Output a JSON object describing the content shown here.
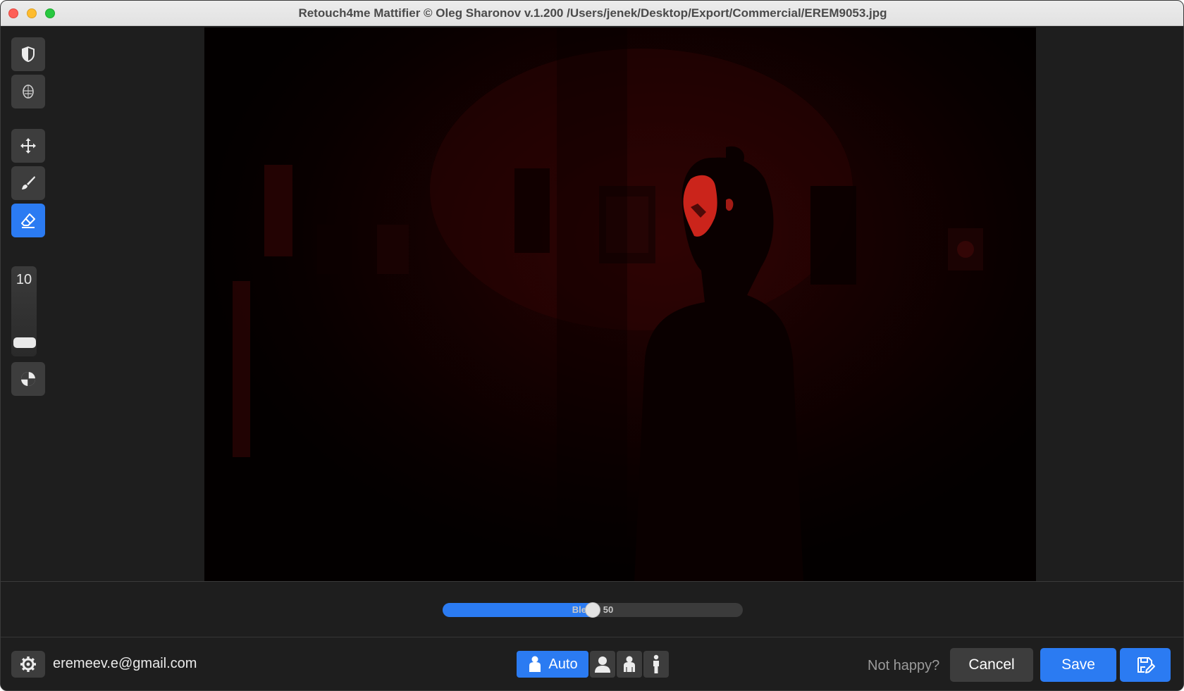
{
  "window": {
    "title": "Retouch4me Mattifier © Oleg Sharonov v.1.200 /Users/jenek/Desktop/Export/Commercial/EREM9053.jpg"
  },
  "toolbar": {
    "tools": [
      {
        "name": "mask-view-icon",
        "active": false
      },
      {
        "name": "face-view-icon",
        "active": false
      },
      {
        "name": "move-icon",
        "active": false
      },
      {
        "name": "brush-icon",
        "active": false
      },
      {
        "name": "eraser-icon",
        "active": true
      },
      {
        "name": "contrast-icon",
        "active": false
      }
    ],
    "brush_size": "10"
  },
  "blend": {
    "label": "Blend: 50",
    "value": 50,
    "max": 100
  },
  "footer": {
    "email": "eremeev.e@gmail.com",
    "modes": [
      {
        "name": "auto-person-icon",
        "label": "Auto",
        "active": true
      },
      {
        "name": "portrait-icon",
        "label": "",
        "active": false
      },
      {
        "name": "half-body-icon",
        "label": "",
        "active": false
      },
      {
        "name": "full-body-icon",
        "label": "",
        "active": false
      }
    ],
    "not_happy": "Not happy?",
    "cancel_label": "Cancel",
    "save_label": "Save"
  },
  "colors": {
    "accent": "#2b7bf2",
    "panel": "#1e1e1e",
    "button": "#3d3d3d",
    "overlay": "#e0281e"
  }
}
